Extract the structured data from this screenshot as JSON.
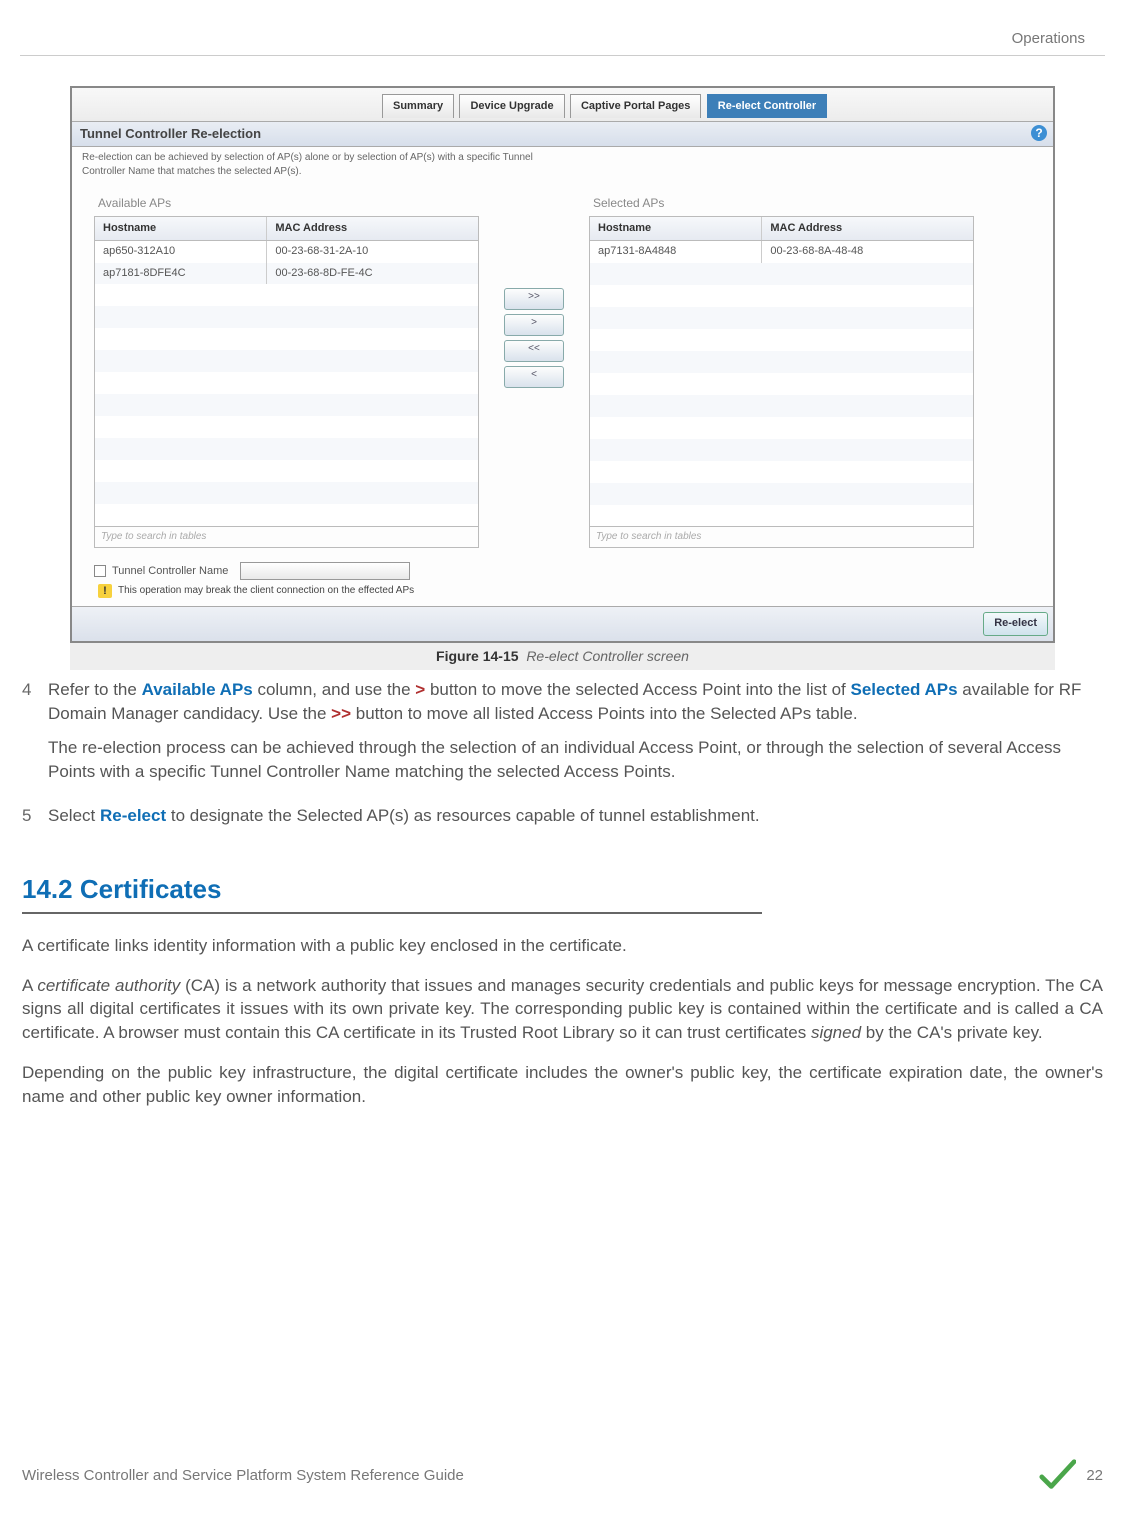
{
  "header": {
    "title": "Operations"
  },
  "screenshot": {
    "tabs": [
      "Summary",
      "Device Upgrade",
      "Captive Portal Pages",
      "Re-elect Controller"
    ],
    "active_tab_index": 3,
    "panel_title": "Tunnel Controller Re-election",
    "help_icon": "?",
    "description": "Re-election can be achieved by selection of AP(s) alone or by selection of AP(s) with a specific Tunnel Controller Name that matches the selected AP(s).",
    "available": {
      "label": "Available APs",
      "cols": [
        "Hostname",
        "MAC Address"
      ],
      "rows": [
        {
          "host": "ap650-312A10",
          "mac": "00-23-68-31-2A-10"
        },
        {
          "host": "ap7181-8DFE4C",
          "mac": "00-23-68-8D-FE-4C"
        }
      ],
      "search_placeholder": "Type to search in tables"
    },
    "selected": {
      "label": "Selected APs",
      "cols": [
        "Hostname",
        "MAC Address"
      ],
      "rows": [
        {
          "host": "ap7131-8A4848",
          "mac": "00-23-68-8A-48-48"
        }
      ],
      "search_placeholder": "Type to search in tables"
    },
    "mid_buttons": [
      ">>",
      ">",
      "<<",
      "<"
    ],
    "tunnel_checkbox_label": "Tunnel Controller Name",
    "warning_text": "This operation may break the client connection on the effected APs",
    "reelect_button": "Re-elect"
  },
  "caption": {
    "label": "Figure 14-15",
    "text": "Re-elect Controller screen"
  },
  "steps": {
    "s4": {
      "num": "4",
      "p1_a": "Refer to the ",
      "p1_b": "Available APs",
      "p1_c": " column, and use the ",
      "p1_d": ">",
      "p1_e": " button to move the selected Access Point into the list of ",
      "p1_f": "Selected APs",
      "p1_g": " available for RF Domain Manager candidacy. Use the ",
      "p1_h": ">>",
      "p1_i": " button to move all listed Access Points into the Selected APs table.",
      "p2": "The re-election process can be achieved through the selection of an individual Access Point, or through the selection of several Access Points with a specific Tunnel Controller Name matching the selected Access Points."
    },
    "s5": {
      "num": "5",
      "a": "Select ",
      "b": "Re-elect",
      "c": " to designate the Selected AP(s) as resources capable of tunnel establishment."
    }
  },
  "section": {
    "title": "14.2 Certificates"
  },
  "body": {
    "p1": "A certificate links identity information with a public key enclosed in the certificate.",
    "p2a": "A ",
    "p2b": "certificate authority",
    "p2c": " (CA) is a network authority that issues and manages security credentials and public keys for message encryption. The CA signs all digital certificates it issues with its own private key. The corresponding public key is contained within the certificate and is called a CA certificate. A browser must contain this CA certificate in its Trusted Root Library so it can trust certificates ",
    "p2d": "signed",
    "p2e": " by the CA's private key.",
    "p3": "Depending on the public key infrastructure, the digital certificate includes the owner's public key, the certificate expiration date, the owner's name and other public key owner information."
  },
  "footer": {
    "guide": "Wireless Controller and Service Platform System Reference Guide",
    "page": "22"
  }
}
